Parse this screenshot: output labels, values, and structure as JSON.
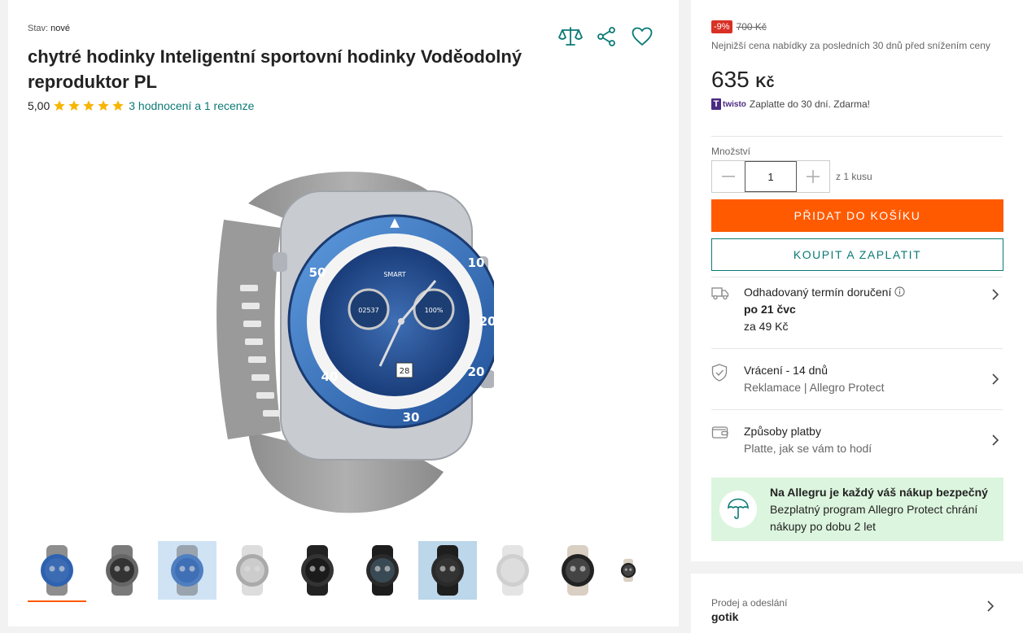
{
  "product": {
    "condition_label": "Stav:",
    "condition_value": "nové",
    "title": "chytré hodinky Inteligentní sportovní hodinky Voděodolný reproduktor PL",
    "rating_score": "5,00",
    "rating_stars": 5,
    "rating_link": "3 hodnocení a 1 recenze",
    "thumbnail_count": 10
  },
  "icons": {
    "compare": "scales-icon",
    "share": "share-icon",
    "favorite": "heart-icon"
  },
  "pricing": {
    "discount": "-9%",
    "old_price": "700 Kč",
    "lowest_note": "Nejnižší cena nabídky za posledních 30 dnů před snížením ceny",
    "price_amount": "635",
    "price_currency": "Kč",
    "twisto_brand": "twisto",
    "twisto_text": "Zaplatte do 30 dní. Zdarma!"
  },
  "quantity": {
    "label": "Množství",
    "value": "1",
    "of_text": "z 1 kusu"
  },
  "buttons": {
    "add_to_cart": "PŘIDAT DO KOŠÍKU",
    "buy_now": "KOUPIT A ZAPLATIT"
  },
  "delivery": {
    "title": "Odhadovaný termín doručení",
    "date": "po 21 čvc",
    "price": "za 49 Kč"
  },
  "returns": {
    "title": "Vrácení - 14 dnů",
    "sub": "Reklamace | Allegro Protect"
  },
  "payment": {
    "title": "Způsoby platby",
    "sub": "Platte, jak se vám to hodí"
  },
  "protect": {
    "title": "Na Allegru je každý váš nákup bezpečný",
    "text": "Bezplatný program Allegro Protect chrání nákupy po dobu 2 let"
  },
  "seller": {
    "label": "Prodej a odeslání",
    "name": "gotik"
  },
  "colors": {
    "accent_orange": "#ff5a00",
    "accent_teal": "#0b7a75",
    "discount_red": "#d93025",
    "protect_bg": "#dcf5de",
    "star_gold": "#f7b500"
  }
}
